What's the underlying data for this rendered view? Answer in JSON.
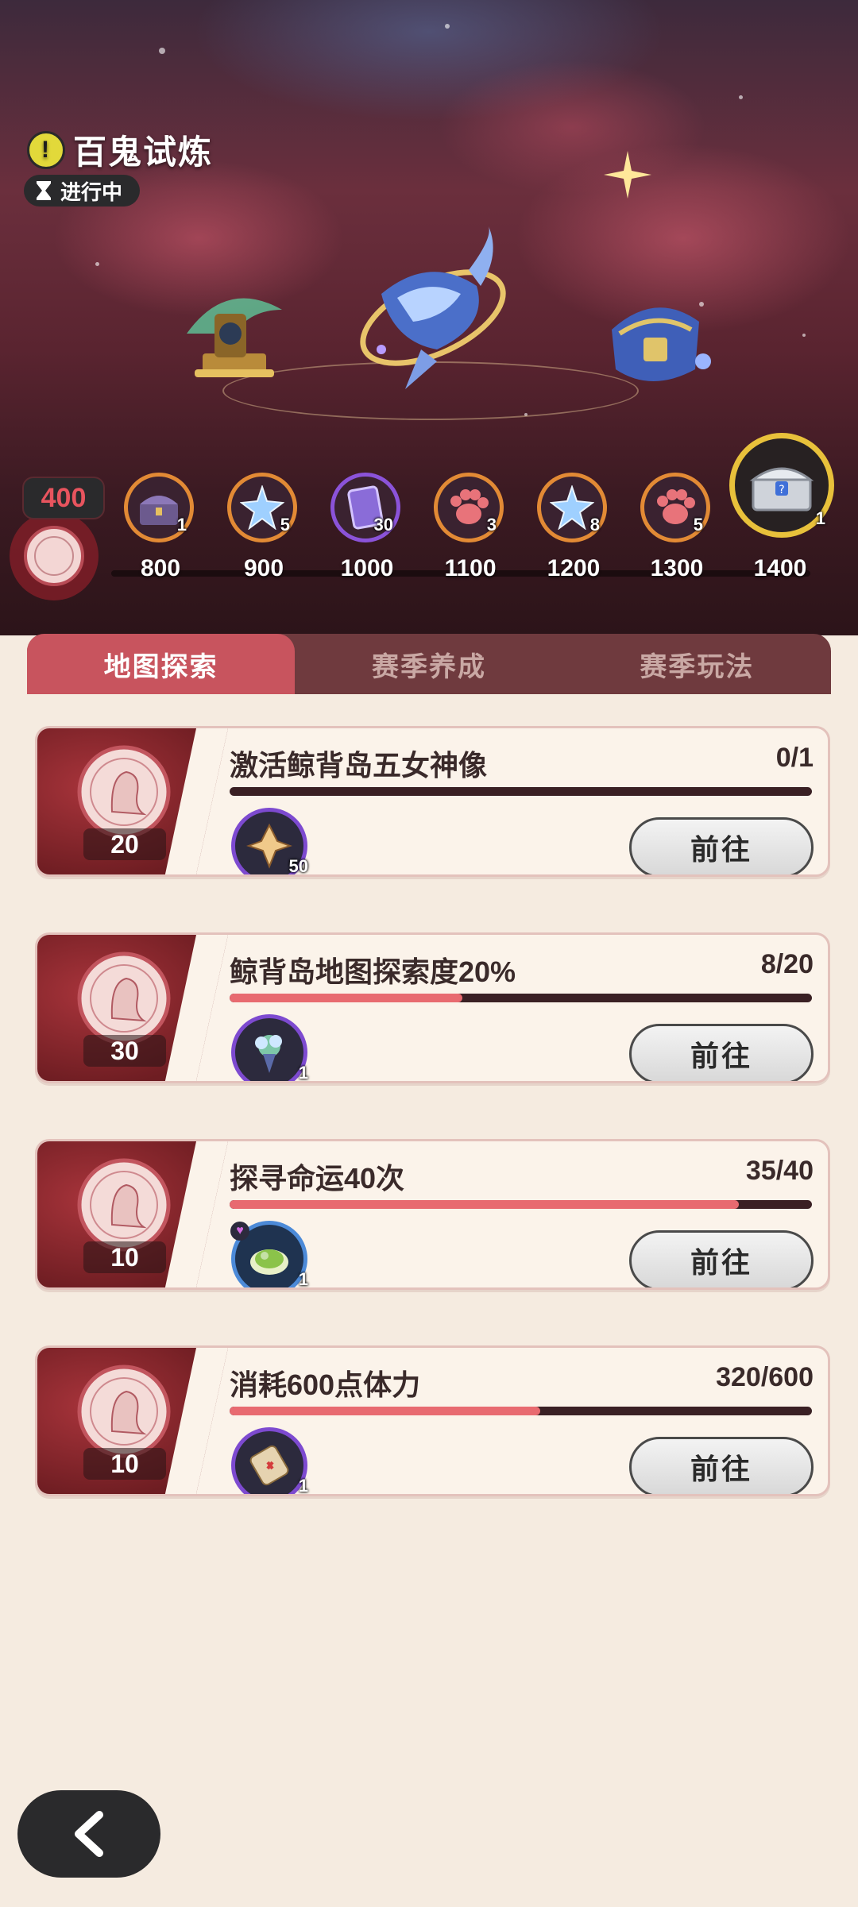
{
  "event": {
    "title": "百鬼试炼",
    "status": "进行中"
  },
  "points": {
    "current": "400"
  },
  "milestones": [
    {
      "threshold": "800",
      "count": "1",
      "icon": "treasure-chest-icon"
    },
    {
      "threshold": "900",
      "count": "5",
      "icon": "crystal-star-icon"
    },
    {
      "threshold": "1000",
      "count": "30",
      "icon": "purple-card-icon"
    },
    {
      "threshold": "1100",
      "count": "3",
      "icon": "paw-icon"
    },
    {
      "threshold": "1200",
      "count": "8",
      "icon": "crystal-star-icon"
    },
    {
      "threshold": "1300",
      "count": "5",
      "icon": "paw-icon"
    },
    {
      "threshold": "1400",
      "count": "1",
      "icon": "golden-chest-icon"
    }
  ],
  "tabs": [
    {
      "label": "地图探索",
      "active": true
    },
    {
      "label": "赛季养成",
      "active": false
    },
    {
      "label": "赛季玩法",
      "active": false
    }
  ],
  "tasks": [
    {
      "title": "激活鲸背岛五女神像",
      "progress_text": "0/1",
      "progress": 0.0,
      "reward": "20",
      "item_count": "50",
      "item_icon": "gold-shard-icon",
      "button": "前往"
    },
    {
      "title": "鲸背岛地图探索度20%",
      "progress_text": "8/20",
      "progress": 0.4,
      "reward": "30",
      "item_count": "1",
      "item_icon": "bouquet-icon",
      "button": "前往"
    },
    {
      "title": "探寻命运40次",
      "progress_text": "35/40",
      "progress": 0.875,
      "reward": "10",
      "item_count": "1",
      "item_icon": "green-food-icon",
      "button": "前往"
    },
    {
      "title": "消耗600点体力",
      "progress_text": "320/600",
      "progress": 0.533,
      "reward": "10",
      "item_count": "1",
      "item_icon": "scroll-icon",
      "button": "前往"
    }
  ],
  "colors": {
    "accent": "#c8545e",
    "progress_fill": "#e86a70",
    "milestone_orange": "#e28a35",
    "milestone_purple": "#8b53d9",
    "milestone_gold": "#e8c13b"
  }
}
